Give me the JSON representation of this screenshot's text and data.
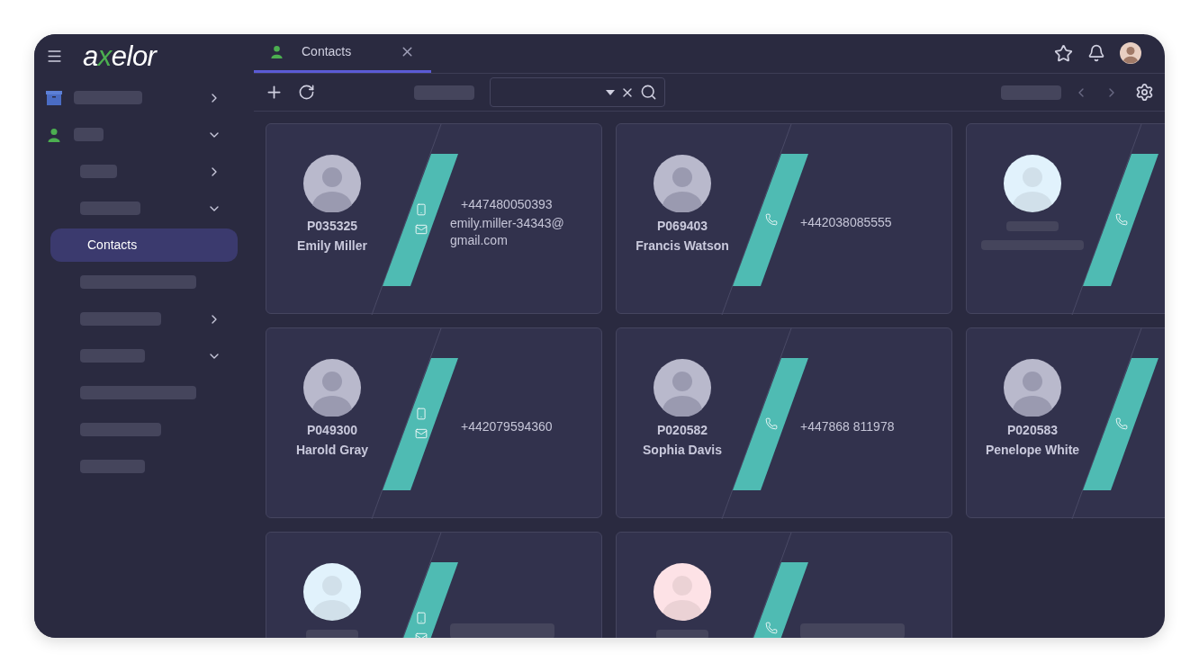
{
  "header": {
    "logo": "axelor"
  },
  "sidebar": {
    "items": [
      {
        "kind": "folder",
        "expanded": false,
        "selected": false
      },
      {
        "kind": "folder",
        "expanded": true,
        "selected": false,
        "children": [
          {
            "kind": "folder",
            "expanded": false,
            "selected": false
          },
          {
            "kind": "folder",
            "expanded": true,
            "selected": false
          },
          {
            "kind": "link",
            "label": "Contacts",
            "selected": true
          },
          {
            "kind": "link",
            "selected": false
          },
          {
            "kind": "folder",
            "expanded": false,
            "selected": false
          },
          {
            "kind": "folder",
            "expanded": true,
            "selected": false
          },
          {
            "kind": "link",
            "selected": false
          },
          {
            "kind": "link",
            "selected": false
          },
          {
            "kind": "link",
            "selected": false
          }
        ]
      }
    ]
  },
  "tabs": [
    {
      "label": "Contacts",
      "selected": true
    }
  ],
  "cards": [
    {
      "code": "P035325",
      "name": "Emily Miller",
      "avatar": {
        "kind": "photo"
      },
      "channels": [
        {
          "kind": "mobile"
        },
        {
          "kind": "email"
        }
      ],
      "lines": [
        "+447480050393",
        "emily.miller-34343@gmail.com"
      ]
    },
    {
      "code": "P069403",
      "name": "Francis Watson",
      "avatar": {
        "kind": "photo"
      },
      "channels": [
        {
          "kind": "phone"
        }
      ],
      "lines": [
        "+442038085555"
      ]
    },
    {
      "avatar": {
        "kind": "default",
        "color": "#e1f2fc"
      },
      "channels": [
        {
          "kind": "phone"
        }
      ]
    },
    {
      "code": "P049300",
      "name": "Harold Gray",
      "avatar": {
        "kind": "photo"
      },
      "channels": [
        {
          "kind": "mobile"
        },
        {
          "kind": "email"
        }
      ],
      "lines": [
        "+442079594360"
      ]
    },
    {
      "code": "P020582",
      "name": "Sophia Davis",
      "avatar": {
        "kind": "photo"
      },
      "channels": [
        {
          "kind": "phone"
        }
      ],
      "lines": [
        "+447868 811978"
      ]
    },
    {
      "code": "P020583",
      "name": "Penelope White",
      "avatar": {
        "kind": "photo"
      },
      "channels": [
        {
          "kind": "phone"
        }
      ]
    },
    {
      "avatar": {
        "kind": "default",
        "color": "#e1f2fc"
      },
      "channels": [
        {
          "kind": "mobile"
        },
        {
          "kind": "email"
        }
      ],
      "redacted_line": true
    },
    {
      "avatar": {
        "kind": "default",
        "color": "#fde2e6"
      },
      "channels": [
        {
          "kind": "phone"
        }
      ],
      "redacted_line": true
    }
  ]
}
